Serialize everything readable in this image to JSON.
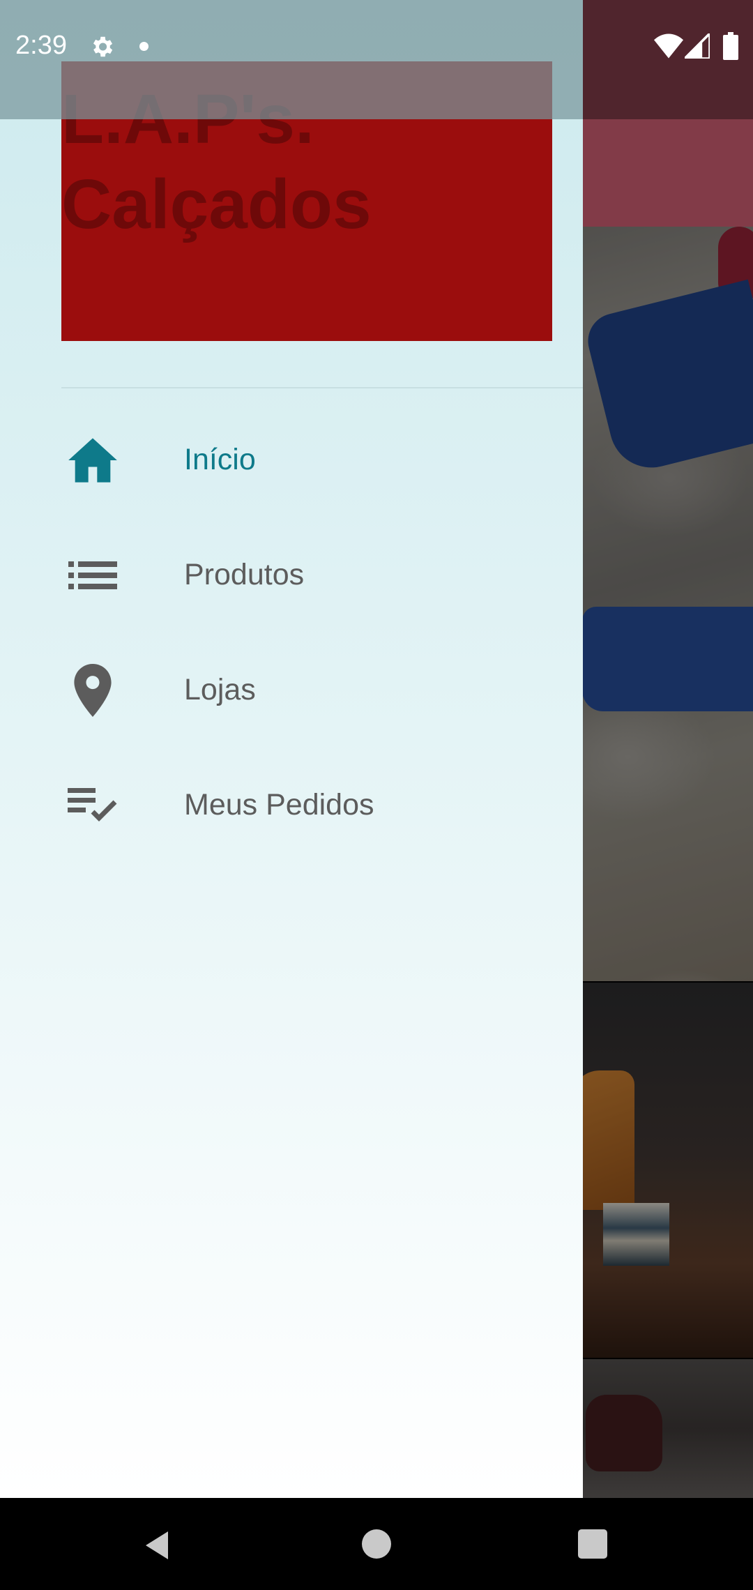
{
  "status_bar": {
    "time": "2:39",
    "icons": [
      "gear-icon",
      "notification-dot-icon",
      "wifi-icon",
      "signal-icon",
      "battery-icon"
    ]
  },
  "drawer": {
    "header": {
      "title": "L.A.P's.\nCalçados",
      "background_color": "#9b0d0d"
    },
    "menu": [
      {
        "label": "Início",
        "icon": "home-icon",
        "active": true
      },
      {
        "label": "Produtos",
        "icon": "list-icon",
        "active": false
      },
      {
        "label": "Lojas",
        "icon": "location-pin-icon",
        "active": false
      },
      {
        "label": "Meus Pedidos",
        "icon": "playlist-check-icon",
        "active": false
      }
    ],
    "accent_color": "#0e7a8a",
    "inactive_color": "#5c5c5c"
  },
  "nav_bar": {
    "buttons": [
      "back-icon",
      "home-circle-icon",
      "recents-square-icon"
    ]
  }
}
